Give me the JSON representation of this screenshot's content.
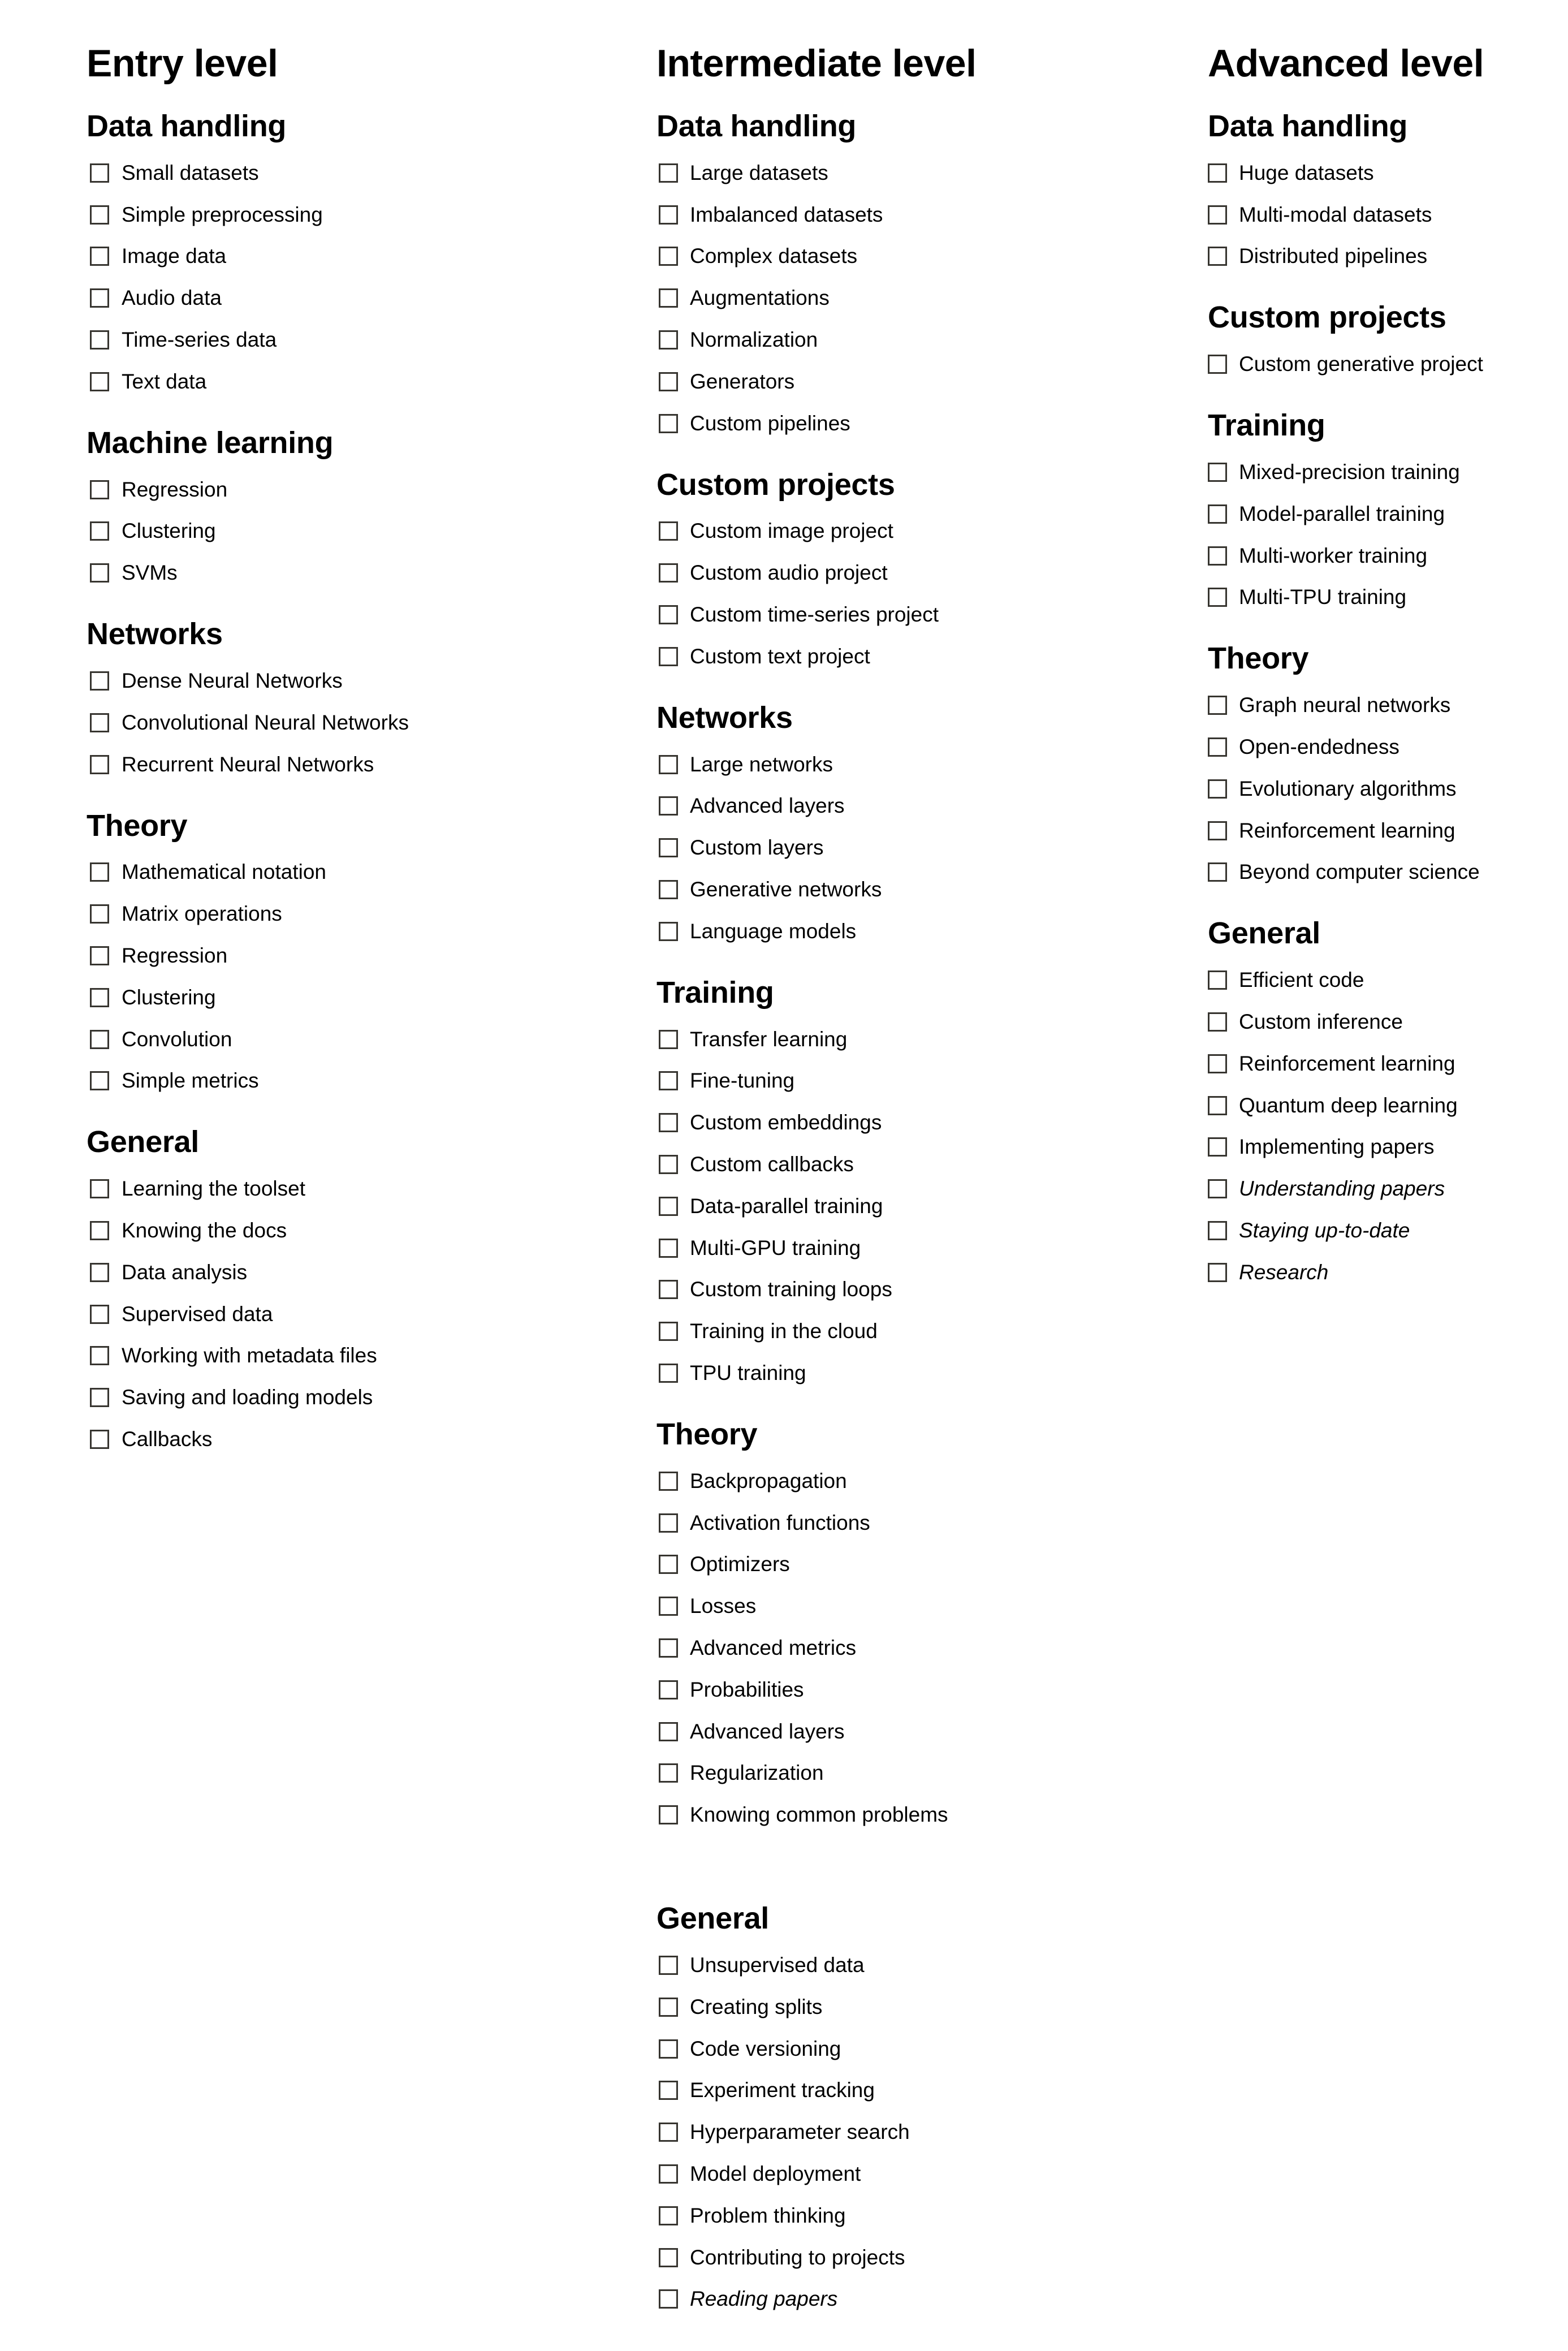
{
  "columns": [
    {
      "title": "Entry level",
      "sections": [
        {
          "title": "Data handling",
          "items": [
            {
              "label": "Small datasets",
              "checked": false,
              "italic": false
            },
            {
              "label": "Simple preprocessing",
              "checked": false,
              "italic": false
            },
            {
              "label": "Image data",
              "checked": false,
              "italic": false
            },
            {
              "label": "Audio data",
              "checked": false,
              "italic": false
            },
            {
              "label": "Time-series data",
              "checked": false,
              "italic": false
            },
            {
              "label": "Text data",
              "checked": false,
              "italic": false
            }
          ]
        },
        {
          "title": "Machine learning",
          "items": [
            {
              "label": "Regression",
              "checked": false,
              "italic": false
            },
            {
              "label": "Clustering",
              "checked": false,
              "italic": false
            },
            {
              "label": "SVMs",
              "checked": false,
              "italic": false
            }
          ]
        },
        {
          "title": "Networks",
          "items": [
            {
              "label": "Dense Neural Networks",
              "checked": false,
              "italic": false
            },
            {
              "label": "Convolutional Neural Networks",
              "checked": false,
              "italic": false
            },
            {
              "label": "Recurrent Neural Networks",
              "checked": false,
              "italic": false
            }
          ]
        },
        {
          "title": "Theory",
          "items": [
            {
              "label": "Mathematical notation",
              "checked": false,
              "italic": false
            },
            {
              "label": "Matrix operations",
              "checked": false,
              "italic": false
            },
            {
              "label": "Regression",
              "checked": false,
              "italic": false
            },
            {
              "label": "Clustering",
              "checked": false,
              "italic": false
            },
            {
              "label": "Convolution",
              "checked": false,
              "italic": false
            },
            {
              "label": "Simple metrics",
              "checked": false,
              "italic": false
            }
          ]
        },
        {
          "title": "General",
          "items": [
            {
              "label": "Learning the toolset",
              "checked": false,
              "italic": false
            },
            {
              "label": "Knowing the docs",
              "checked": false,
              "italic": false
            },
            {
              "label": "Data analysis",
              "checked": false,
              "italic": false
            },
            {
              "label": "Supervised data",
              "checked": false,
              "italic": false
            },
            {
              "label": "Working with metadata files",
              "checked": false,
              "italic": false
            },
            {
              "label": "Saving and loading models",
              "checked": false,
              "italic": false
            },
            {
              "label": "Callbacks",
              "checked": false,
              "italic": false
            }
          ]
        }
      ]
    },
    {
      "title": "Intermediate level",
      "sections": [
        {
          "title": "Data handling",
          "items": [
            {
              "label": "Large datasets",
              "checked": false,
              "italic": false
            },
            {
              "label": "Imbalanced datasets",
              "checked": false,
              "italic": false
            },
            {
              "label": "Complex datasets",
              "checked": false,
              "italic": false
            },
            {
              "label": "Augmentations",
              "checked": false,
              "italic": false
            },
            {
              "label": "Normalization",
              "checked": false,
              "italic": false
            },
            {
              "label": "Generators",
              "checked": false,
              "italic": false
            },
            {
              "label": "Custom pipelines",
              "checked": false,
              "italic": false
            }
          ]
        },
        {
          "title": "Custom projects",
          "items": [
            {
              "label": "Custom image project",
              "checked": false,
              "italic": false
            },
            {
              "label": "Custom audio project",
              "checked": false,
              "italic": false
            },
            {
              "label": "Custom time-series project",
              "checked": false,
              "italic": false
            },
            {
              "label": "Custom text project",
              "checked": false,
              "italic": false
            }
          ]
        },
        {
          "title": "Networks",
          "items": [
            {
              "label": "Large networks",
              "checked": false,
              "italic": false
            },
            {
              "label": "Advanced layers",
              "checked": false,
              "italic": false
            },
            {
              "label": "Custom layers",
              "checked": false,
              "italic": false
            },
            {
              "label": "Generative networks",
              "checked": false,
              "italic": false
            },
            {
              "label": "Language models",
              "checked": false,
              "italic": false
            }
          ]
        },
        {
          "title": "Training",
          "items": [
            {
              "label": "Transfer learning",
              "checked": false,
              "italic": false
            },
            {
              "label": "Fine-tuning",
              "checked": false,
              "italic": false
            },
            {
              "label": "Custom embeddings",
              "checked": false,
              "italic": false
            },
            {
              "label": "Custom callbacks",
              "checked": false,
              "italic": false
            },
            {
              "label": "Data-parallel training",
              "checked": false,
              "italic": false
            },
            {
              "label": "Multi-GPU training",
              "checked": false,
              "italic": false
            },
            {
              "label": "Custom training loops",
              "checked": false,
              "italic": false
            },
            {
              "label": "Training in the cloud",
              "checked": false,
              "italic": false
            },
            {
              "label": "TPU training",
              "checked": false,
              "italic": false
            }
          ]
        },
        {
          "title": "Theory",
          "items": [
            {
              "label": "Backpropagation",
              "checked": false,
              "italic": false
            },
            {
              "label": "Activation functions",
              "checked": false,
              "italic": false
            },
            {
              "label": "Optimizers",
              "checked": false,
              "italic": false
            },
            {
              "label": "Losses",
              "checked": false,
              "italic": false
            },
            {
              "label": "Advanced metrics",
              "checked": false,
              "italic": false
            },
            {
              "label": "Probabilities",
              "checked": false,
              "italic": false
            },
            {
              "label": "Advanced layers",
              "checked": false,
              "italic": false
            },
            {
              "label": "Regularization",
              "checked": false,
              "italic": false
            },
            {
              "label": "Knowing common problems",
              "checked": false,
              "italic": false
            }
          ],
          "trailing_blank_line": true
        },
        {
          "title": "General",
          "items": [
            {
              "label": "Unsupervised data",
              "checked": false,
              "italic": false
            },
            {
              "label": "Creating splits",
              "checked": false,
              "italic": false
            },
            {
              "label": "Code versioning",
              "checked": false,
              "italic": false
            },
            {
              "label": "Experiment tracking",
              "checked": false,
              "italic": false
            },
            {
              "label": "Hyperparameter search",
              "checked": false,
              "italic": false
            },
            {
              "label": "Model deployment",
              "checked": false,
              "italic": false
            },
            {
              "label": "Problem thinking",
              "checked": false,
              "italic": false
            },
            {
              "label": "Contributing to projects",
              "checked": false,
              "italic": false
            },
            {
              "label": "Reading papers",
              "checked": false,
              "italic": true
            }
          ]
        }
      ]
    },
    {
      "title": "Advanced level",
      "sections": [
        {
          "title": "Data handling",
          "items": [
            {
              "label": "Huge datasets",
              "checked": false,
              "italic": false
            },
            {
              "label": "Multi-modal datasets",
              "checked": false,
              "italic": false
            },
            {
              "label": "Distributed pipelines",
              "checked": false,
              "italic": false
            }
          ]
        },
        {
          "title": "Custom projects",
          "items": [
            {
              "label": "Custom generative project",
              "checked": false,
              "italic": false
            }
          ]
        },
        {
          "title": "Training",
          "items": [
            {
              "label": "Mixed-precision training",
              "checked": false,
              "italic": false
            },
            {
              "label": "Model-parallel training",
              "checked": false,
              "italic": false
            },
            {
              "label": "Multi-worker training",
              "checked": false,
              "italic": false
            },
            {
              "label": "Multi-TPU training",
              "checked": false,
              "italic": false
            }
          ]
        },
        {
          "title": "Theory",
          "items": [
            {
              "label": "Graph neural networks",
              "checked": false,
              "italic": false
            },
            {
              "label": "Open-endedness",
              "checked": false,
              "italic": false
            },
            {
              "label": "Evolutionary algorithms",
              "checked": false,
              "italic": false
            },
            {
              "label": "Reinforcement learning",
              "checked": false,
              "italic": false
            },
            {
              "label": "Beyond computer science",
              "checked": false,
              "italic": false
            }
          ]
        },
        {
          "title": "General",
          "items": [
            {
              "label": "Efficient code",
              "checked": false,
              "italic": false
            },
            {
              "label": "Custom inference",
              "checked": false,
              "italic": false
            },
            {
              "label": "Reinforcement learning",
              "checked": false,
              "italic": false
            },
            {
              "label": "Quantum deep learning",
              "checked": false,
              "italic": false
            },
            {
              "label": "Implementing papers",
              "checked": false,
              "italic": false
            },
            {
              "label": "Understanding papers",
              "checked": false,
              "italic": true
            },
            {
              "label": "Staying up-to-date",
              "checked": false,
              "italic": true
            },
            {
              "label": "Research",
              "checked": false,
              "italic": true
            }
          ]
        }
      ]
    }
  ],
  "colors": {
    "text": "#000000",
    "checkbox_border": "#373530",
    "background": "#ffffff"
  },
  "icons": {
    "checkbox": "checkbox-unchecked-icon"
  }
}
